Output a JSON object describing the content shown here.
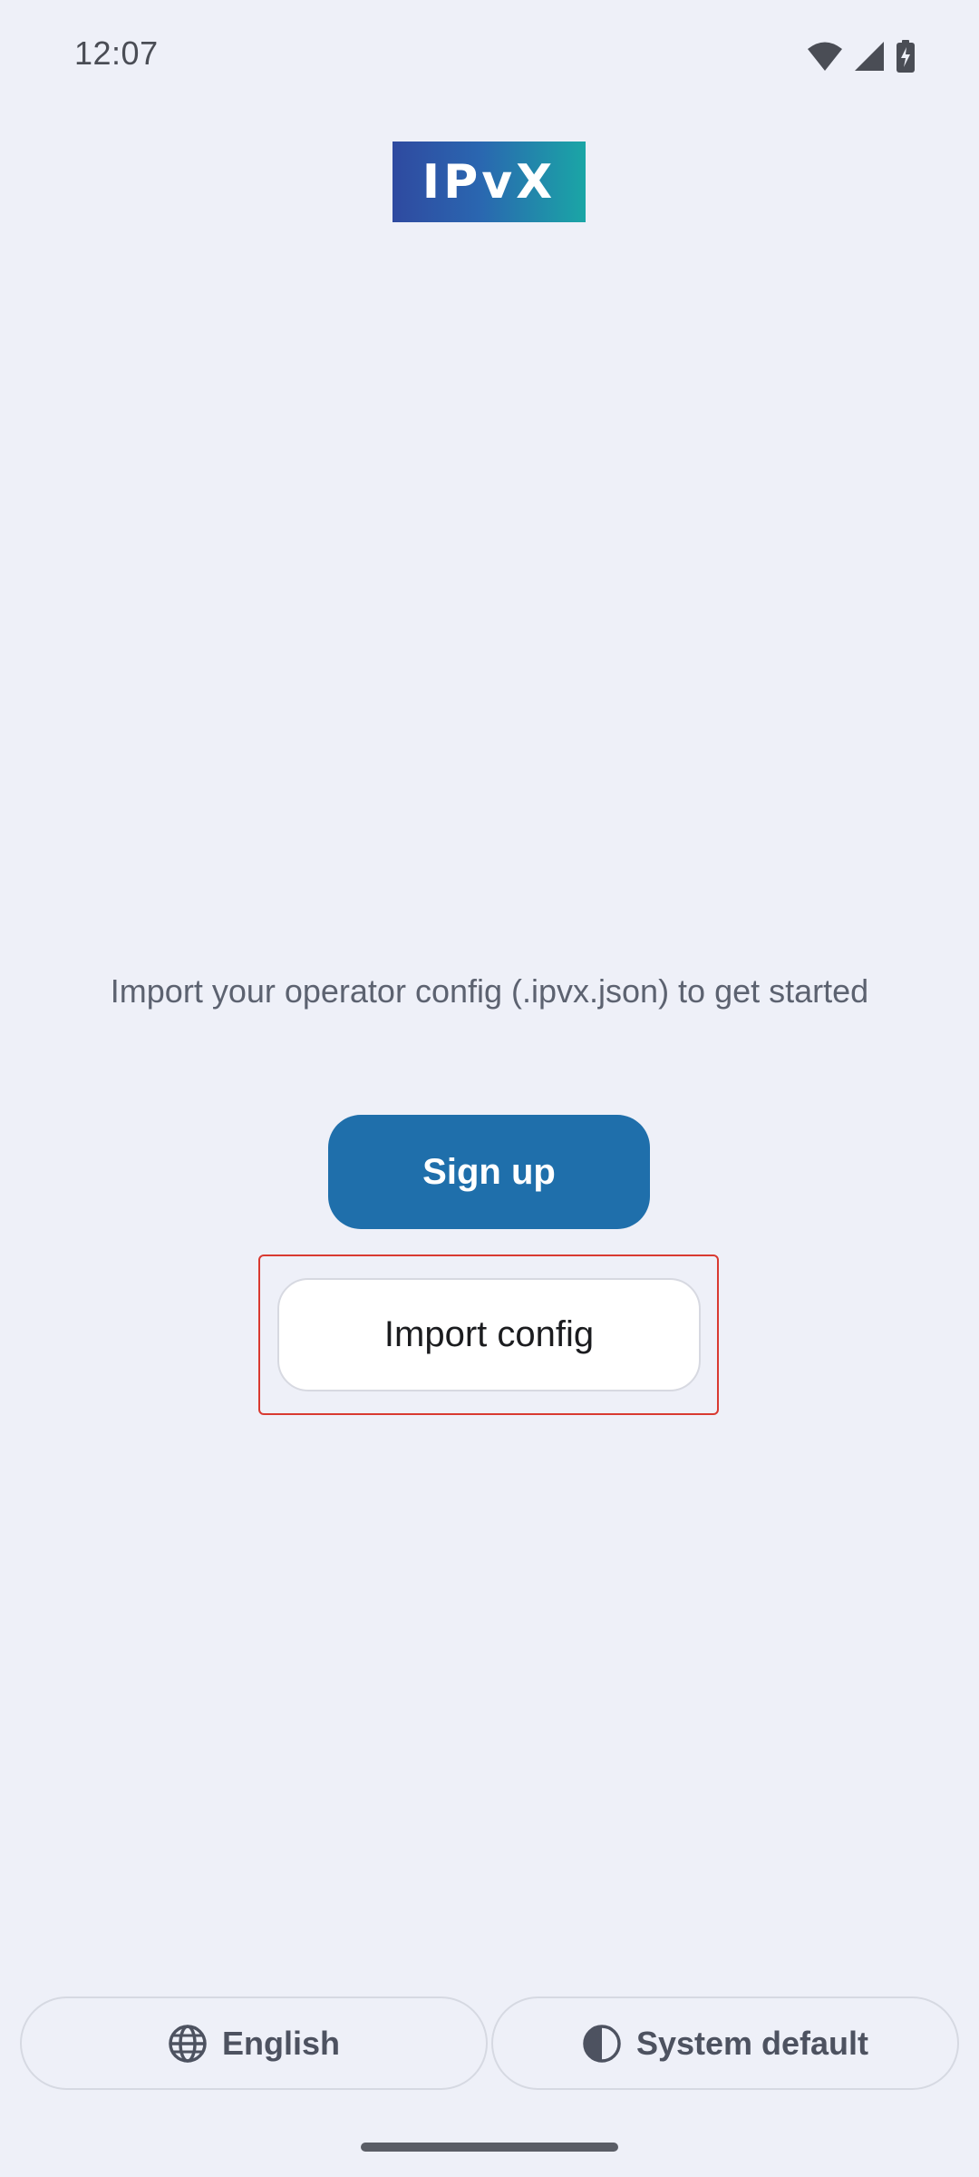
{
  "status_bar": {
    "time": "12:07",
    "icons": [
      "wifi-icon",
      "cellular-signal-icon",
      "battery-charging-icon"
    ]
  },
  "logo": {
    "text": "IPvX",
    "colors": [
      "#2f4aa0",
      "#1aa6a6"
    ]
  },
  "main": {
    "intro_text": "Import your operator config (.ipvx.json) to get started",
    "signup_label": "Sign up",
    "import_label": "Import config"
  },
  "footer": {
    "language_label": "English",
    "language_icon": "globe-icon",
    "theme_label": "System default",
    "theme_icon": "contrast-icon"
  },
  "colors": {
    "background": "#eef0f8",
    "primary": "#1f6fab",
    "highlight": "#d93a31"
  }
}
